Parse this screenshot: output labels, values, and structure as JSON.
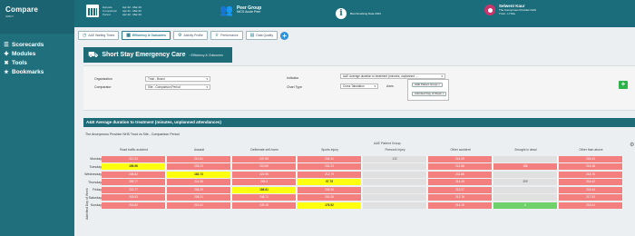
{
  "app": {
    "title": "Compare",
    "subtitle": "GIRFT"
  },
  "sidebar": {
    "items": [
      {
        "label": "Scorecards",
        "icon": "list-icon"
      },
      {
        "label": "Modules",
        "icon": "puzzle-icon"
      },
      {
        "label": "Tools",
        "icon": "tools-icon"
      },
      {
        "label": "Bookmarks",
        "icon": "bookmark-icon"
      }
    ]
  },
  "header": {
    "period": {
      "rows": [
        {
          "label": "Episode",
          "value": "Apr 22 - Mar 23"
        },
        {
          "label": "Comparison",
          "value": "Apr 21 - Mar 22"
        },
        {
          "label": "Period",
          "value": "Apr 22 - Mar 23"
        }
      ]
    },
    "peer": {
      "title": "Peer Group",
      "value": "NICS Acute Peer"
    },
    "info": {
      "text": "Benchmarking Data 2023"
    },
    "user": {
      "name": "Selwent Kaur",
      "org": "The Anonymous Provider NHS",
      "trust": "Trust - LY01a"
    }
  },
  "tabs": [
    {
      "label": "A&E Waiting Times",
      "active": false
    },
    {
      "label": "Efficiency & Outcomes",
      "active": true
    },
    {
      "label": "Activity Profile",
      "active": false
    },
    {
      "label": "Performance",
      "active": false
    },
    {
      "label": "Data Quality",
      "active": false
    }
  ],
  "page": {
    "title": "Short Stay Emergency Care",
    "crumb": "› Efficiency & Outcomes"
  },
  "filters": {
    "organisation_label": "Organisation",
    "organisation_value": "Trust - Board",
    "comparator_label": "Comparator",
    "comparator_value": "Site - Comparison Period",
    "indicator_label": "Indicator",
    "indicator_value": "A&E Average duration to treatment (minutes, unplanned ... ",
    "chart_type_label": "Chart Type",
    "chart_type_value": "Cross Tabulation",
    "axes_label": "Axes",
    "axes_tags": [
      "A&E Patient Group ×",
      "Admitted Day of Week ×"
    ]
  },
  "results": {
    "title": "A&E Average duration to treatment (minutes, unplanned attendances)",
    "comparison": "The Anonymous Provider NHS Trust vs Site - Comparison Period",
    "group_header": "A&E Patient Group",
    "row_axis_label": "Admitted Day of Week",
    "columns": [
      "Road traffic accident",
      "Assault",
      "Deliberate self-harm",
      "Sports injury",
      "Firework injury",
      "Other accident",
      "Brought in dead",
      "Other than above"
    ],
    "rows": [
      {
        "day": "Monday",
        "cells": [
          [
            "r",
            "212.33"
          ],
          [
            "r",
            "210.51"
          ],
          [
            "r",
            "247.55"
          ],
          [
            "r",
            "204.31"
          ],
          [
            "g",
            "132"
          ],
          [
            "r",
            "214.29"
          ],
          [
            "g",
            ""
          ],
          [
            "r",
            "218.43"
          ]
        ]
      },
      {
        "day": "Tuesday",
        "cells": [
          [
            "y",
            "156.96"
          ],
          [
            "r",
            "208.23"
          ],
          [
            "r",
            "220.89"
          ],
          [
            "r",
            "204.23"
          ],
          [
            "g",
            ""
          ],
          [
            "r",
            "212.66"
          ],
          [
            "r",
            "186"
          ],
          [
            "r",
            "216.48"
          ]
        ]
      },
      {
        "day": "Wednesday",
        "cells": [
          [
            "r",
            "208.82"
          ],
          [
            "y",
            "182.73"
          ],
          [
            "r",
            "220.95"
          ],
          [
            "r",
            "212.79"
          ],
          [
            "g",
            ""
          ],
          [
            "r",
            "211.86"
          ],
          [
            "g",
            ""
          ],
          [
            "r",
            "218.76"
          ]
        ]
      },
      {
        "day": "Thursday",
        "cells": [
          [
            "r",
            "205.77"
          ],
          [
            "r",
            "211.08"
          ],
          [
            "r",
            "245.3"
          ],
          [
            "y",
            "97.75"
          ],
          [
            "g",
            ""
          ],
          [
            "r",
            "214.26"
          ],
          [
            "g",
            "399"
          ],
          [
            "r",
            "216.42"
          ]
        ]
      },
      {
        "day": "Friday",
        "cells": [
          [
            "r",
            "220.77"
          ],
          [
            "r",
            "206.29"
          ],
          [
            "y",
            "186.61"
          ],
          [
            "r",
            "205.36"
          ],
          [
            "g",
            ""
          ],
          [
            "r",
            "213.37"
          ],
          [
            "g",
            ""
          ],
          [
            "r",
            "216.44"
          ]
        ]
      },
      {
        "day": "Saturday",
        "cells": [
          [
            "r",
            "218.93"
          ],
          [
            "r",
            "208.21"
          ],
          [
            "r",
            "248.71"
          ],
          [
            "r",
            "200.35"
          ],
          [
            "g",
            ""
          ],
          [
            "r",
            "212.76"
          ],
          [
            "g",
            ""
          ],
          [
            "r",
            "217.93"
          ]
        ]
      },
      {
        "day": "Sunday",
        "cells": [
          [
            "r",
            "216.62"
          ],
          [
            "r",
            "210.41"
          ],
          [
            "r",
            "249.15"
          ],
          [
            "y",
            "176.52"
          ],
          [
            "g",
            ""
          ],
          [
            "r",
            "214.19"
          ],
          [
            "gr",
            "0"
          ],
          [
            "r",
            "215.24"
          ]
        ]
      }
    ]
  }
}
